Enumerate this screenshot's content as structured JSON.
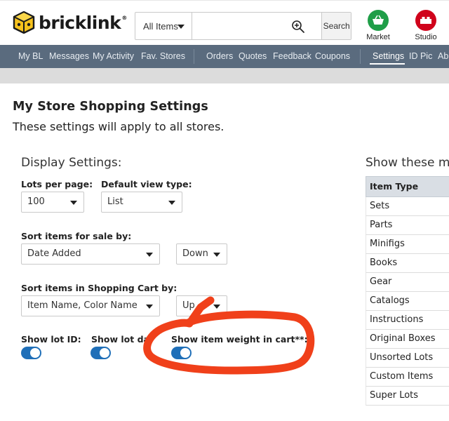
{
  "header": {
    "logo_text": "bricklink",
    "logo_reg": "®",
    "search_type": "All Items",
    "search_placeholder": "",
    "search_button": "Search",
    "apps": [
      {
        "label": "Market",
        "icon": "basket-icon",
        "color": "#1f9e48"
      },
      {
        "label": "Studio",
        "icon": "brick-icon",
        "color": "#d0021b"
      }
    ]
  },
  "nav": {
    "items": [
      "My BL",
      "Messages",
      "My Activity",
      "Fav. Stores",
      "Orders",
      "Quotes",
      "Feedback",
      "Coupons",
      "Settings",
      "ID Pic",
      "Ab"
    ],
    "active": "Settings"
  },
  "page": {
    "title": "My Store Shopping Settings",
    "subtitle": "These settings will apply to all stores."
  },
  "display": {
    "heading": "Display Settings:",
    "lots_per_page_label": "Lots per page:",
    "lots_per_page_value": "100",
    "view_type_label": "Default view type:",
    "view_type_value": "List",
    "sort_sale_label": "Sort items for sale by:",
    "sort_sale_value": "Date Added",
    "sort_sale_dir": "Down",
    "sort_cart_label": "Sort items in Shopping Cart by:",
    "sort_cart_value": "Item Name, Color Name",
    "sort_cart_dir": "Up",
    "show_lot_id_label": "Show lot ID:",
    "show_lot_date_label": "Show lot date",
    "show_weight_label": "Show item weight in cart**:"
  },
  "types": {
    "heading": "Show these m",
    "header": "Item Type",
    "rows": [
      "Sets",
      "Parts",
      "Minifigs",
      "Books",
      "Gear",
      "Catalogs",
      "Instructions",
      "Original Boxes",
      "Unsorted Lots",
      "Custom Items",
      "Super Lots"
    ]
  },
  "colors": {
    "nav_bg": "#5a6b7e",
    "toggle_on": "#1f6fb8",
    "annotation": "#f0401a",
    "market": "#1f9e48",
    "studio": "#d0021b"
  }
}
